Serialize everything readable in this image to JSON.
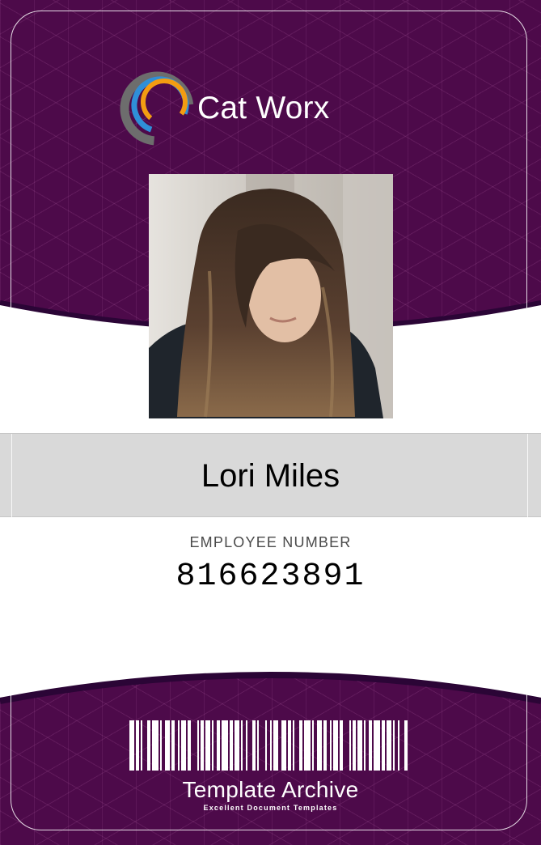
{
  "card": {
    "company": "Cat Worx",
    "employee_name": "Lori Miles",
    "employee_label": "EMPLOYEE NUMBER",
    "employee_number": "816623891",
    "brand_title": "Template Archive",
    "brand_tagline": "Excellent Document Templates"
  },
  "icons": {
    "logo": "crescent-rings-icon",
    "photo": "employee-photo",
    "barcode": "barcode-icon"
  },
  "colors": {
    "band_purple": "#4d0a4a",
    "band_edge": "#2b0536",
    "name_bar": "#d9d9d9",
    "logo_orange": "#f39c12",
    "logo_blue": "#2f8fd8",
    "logo_gray": "#6d6d6d"
  }
}
